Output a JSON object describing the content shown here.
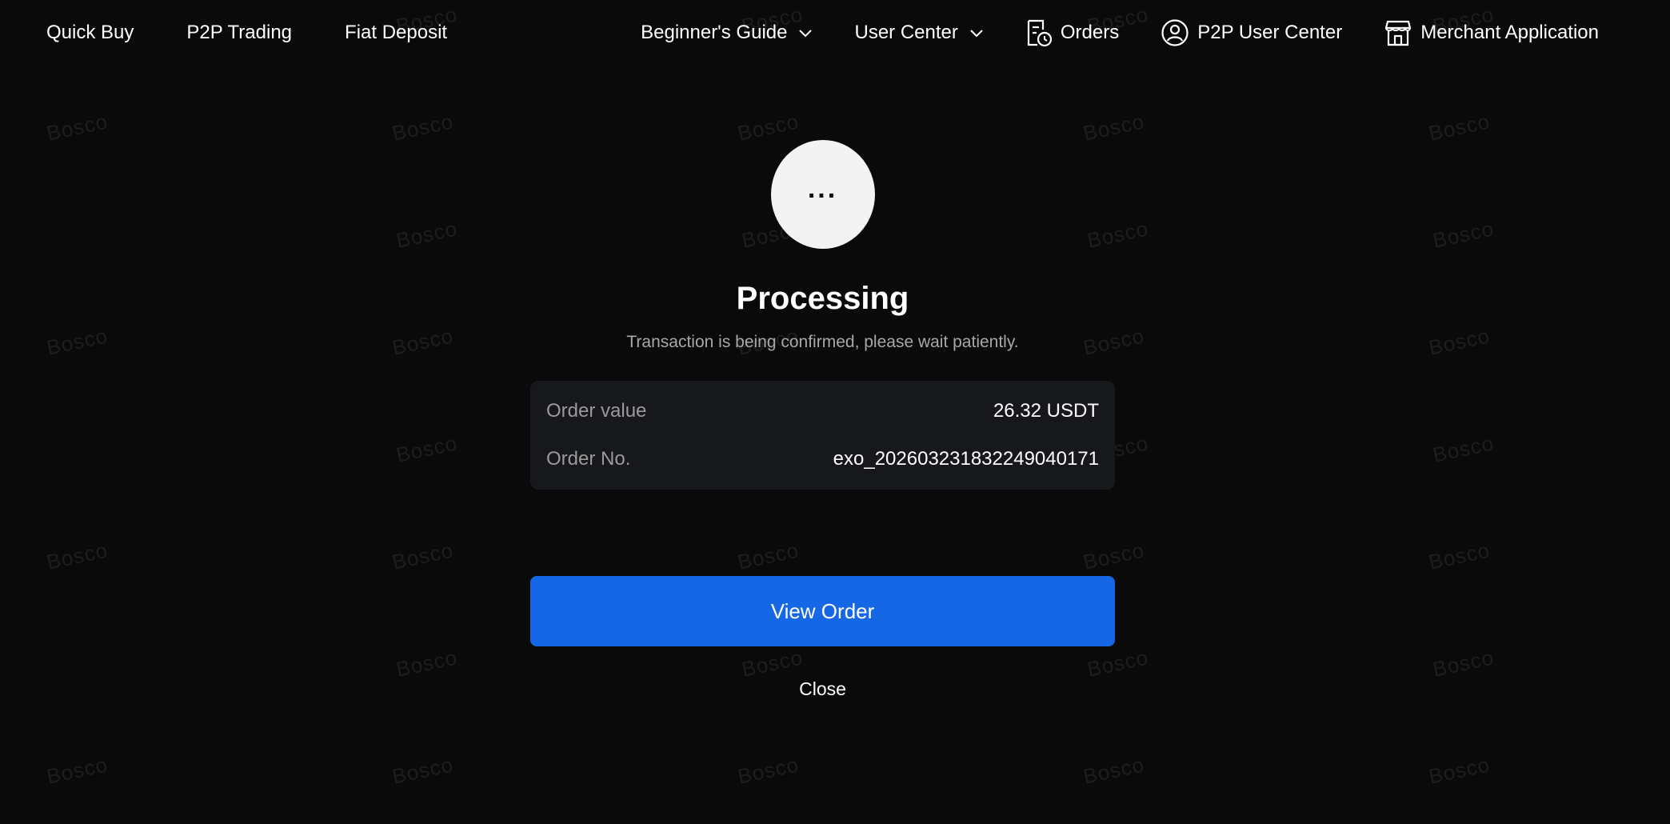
{
  "nav": {
    "left": [
      "Quick Buy",
      "P2P Trading",
      "Fiat Deposit"
    ],
    "beginners_guide": "Beginner's Guide",
    "user_center": "User Center",
    "orders": "Orders",
    "p2p_user_center": "P2P User Center",
    "merchant_application": "Merchant Application"
  },
  "modal": {
    "status_icon": "...",
    "title": "Processing",
    "subtitle": "Transaction is being confirmed, please wait patiently.",
    "order_value_label": "Order value",
    "order_value": "26.32 USDT",
    "order_no_label": "Order No.",
    "order_no": "exo_20260323183224904017​1",
    "view_order_label": "View Order",
    "close_label": "Close"
  },
  "watermark": "Bosco",
  "colors": {
    "background": "#0a0a0a",
    "accent": "#1667e6",
    "card": "#16181b"
  }
}
